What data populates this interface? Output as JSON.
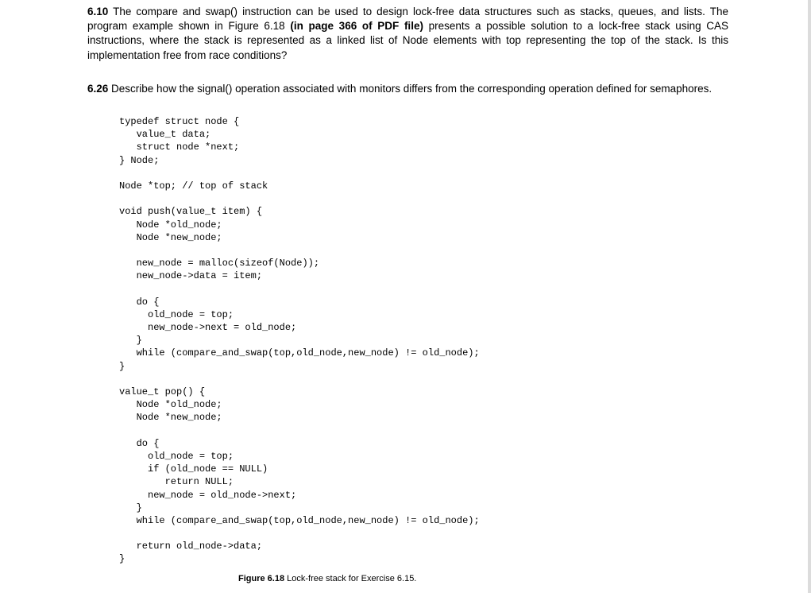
{
  "q1": {
    "num": "6.10",
    "text_a": " The compare and swap() instruction can be used to design lock-free data structures such as stacks, queues, and lists. The program example shown in Figure 6.18 ",
    "bold": "(in page 366 of PDF file)",
    "text_b": " presents a possible solution to a lock-free stack using CAS instructions, where the stack is represented as a linked list of Node elements with top representing the top of the stack. Is this implementation free from race conditions?"
  },
  "q2": {
    "num": "6.26",
    "text": " Describe how the signal() operation associated with monitors differs from the corresponding operation defined for semaphores."
  },
  "code": "typedef struct node {\n   value_t data;\n   struct node *next;\n} Node;\n\nNode *top; // top of stack\n\nvoid push(value_t item) {\n   Node *old_node;\n   Node *new_node;\n\n   new_node = malloc(sizeof(Node));\n   new_node->data = item;\n\n   do {\n     old_node = top;\n     new_node->next = old_node;\n   }\n   while (compare_and_swap(top,old_node,new_node) != old_node);\n}\n\nvalue_t pop() {\n   Node *old_node;\n   Node *new_node;\n\n   do {\n     old_node = top;\n     if (old_node == NULL)\n        return NULL;\n     new_node = old_node->next;\n   }\n   while (compare_and_swap(top,old_node,new_node) != old_node);\n\n   return old_node->data;\n}",
  "figure": {
    "label": "Figure 6.18",
    "caption": "  Lock-free stack for Exercise 6.15."
  }
}
